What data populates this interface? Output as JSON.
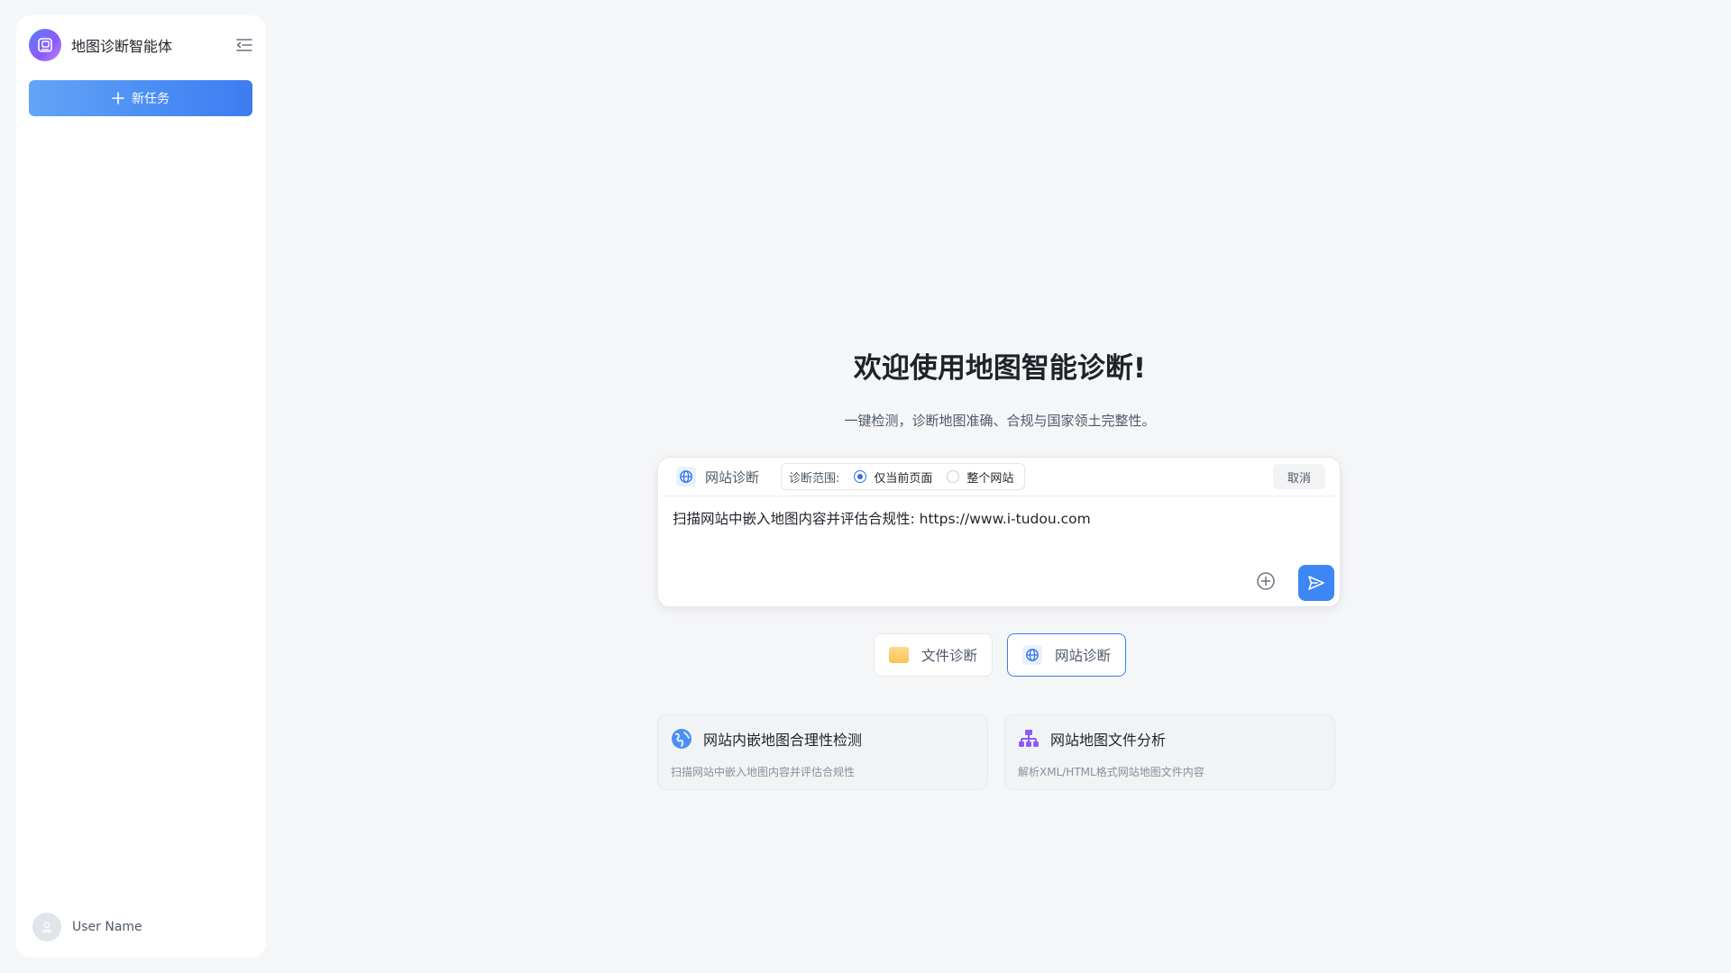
{
  "sidebar": {
    "app_title": "地图诊断智能体",
    "new_task_label": "新任务",
    "user_name": "User Name"
  },
  "welcome": {
    "title": "欢迎使用地图智能诊断!",
    "subtitle": "一键检测，诊断地图准确、合规与国家领土完整性。"
  },
  "input_card": {
    "mode_label": "网站诊断",
    "scope_label": "诊断范围:",
    "scope_options": [
      "仅当前页面",
      "整个网站"
    ],
    "scope_selected": "仅当前页面",
    "cancel_label": "取消",
    "prompt_text": "扫描网站中嵌入地图内容并评估合规性: https://www.i-tudou.com"
  },
  "mode_tabs": [
    {
      "label": "文件诊断",
      "icon": "folder-icon",
      "active": false
    },
    {
      "label": "网站诊断",
      "icon": "globe-icon",
      "active": true
    }
  ],
  "feature_cards": [
    {
      "title": "网站内嵌地图合理性检测",
      "desc": "扫描网站中嵌入地图内容并评估合规性",
      "icon": "earth-icon"
    },
    {
      "title": "网站地图文件分析",
      "desc": "解析XML/HTML格式网站地图文件内容",
      "icon": "sitemap-icon"
    }
  ],
  "colors": {
    "accent": "#3d86f5",
    "background": "#f5f6f8",
    "sitemap_icon": "#8b5cf6"
  }
}
